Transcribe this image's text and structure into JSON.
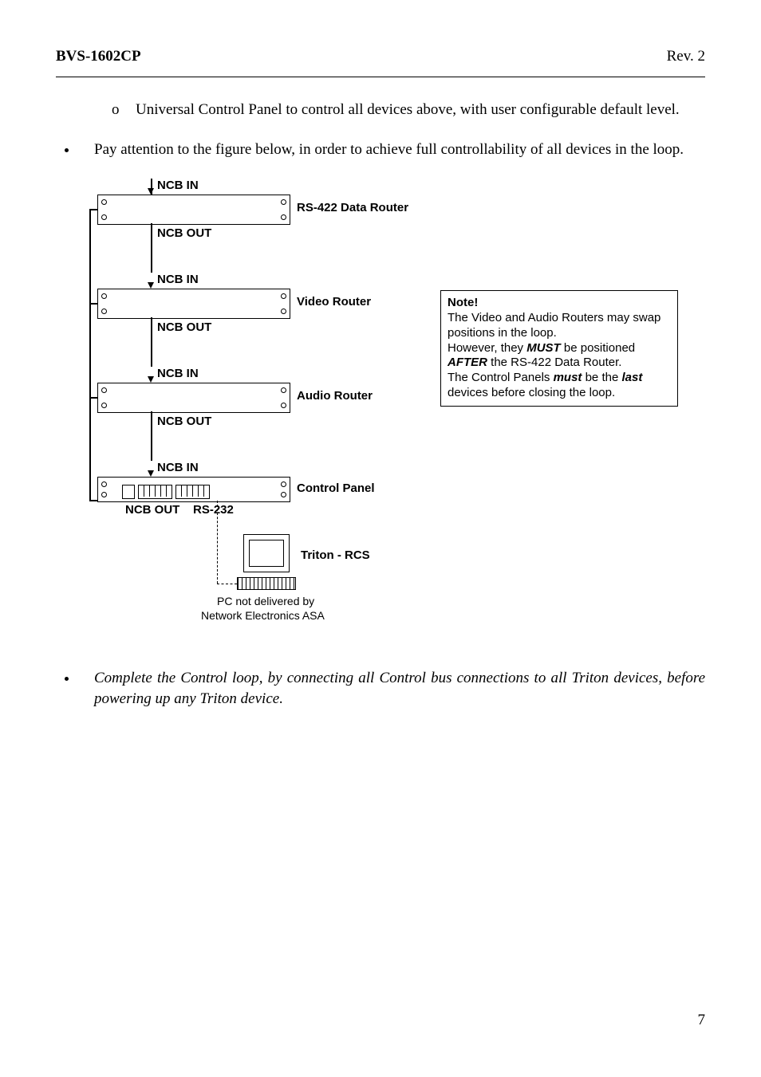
{
  "header": {
    "left": "BVS-1602CP",
    "right": "Rev. 2"
  },
  "bullets": {
    "sub1": "Universal Control Panel to control all devices above, with user configurable default level.",
    "b1": "Pay attention to the figure below, in order to achieve full controllability of all devices in the loop.",
    "b2": "Complete the Control loop, by connecting all Control bus connections to all Triton devices, before powering up any Triton device"
  },
  "fig": {
    "ncb_in": "NCB IN",
    "ncb_out": "NCB OUT",
    "rs232": "RS-232",
    "dev1": "RS-422 Data Router",
    "dev2": "Video Router",
    "dev3": "Audio Router",
    "dev4": "Control Panel",
    "triton": "Triton - RCS",
    "pc_note1": "PC not delivered by",
    "pc_note2": "Network Electronics ASA"
  },
  "note": {
    "title": "Note!",
    "l1": "The Video and Audio Routers may swap positions in the loop.",
    "l2a": "However, they ",
    "l2b": "MUST",
    "l2c": " be positioned ",
    "l3a": "AFTER",
    "l3b": " the RS-422 Data Router.",
    "l4a": "The Control Panels ",
    "l4b": "must",
    "l4c": " be the ",
    "l4d": "last",
    "l5": "devices before closing the loop."
  },
  "pagenum": "7"
}
